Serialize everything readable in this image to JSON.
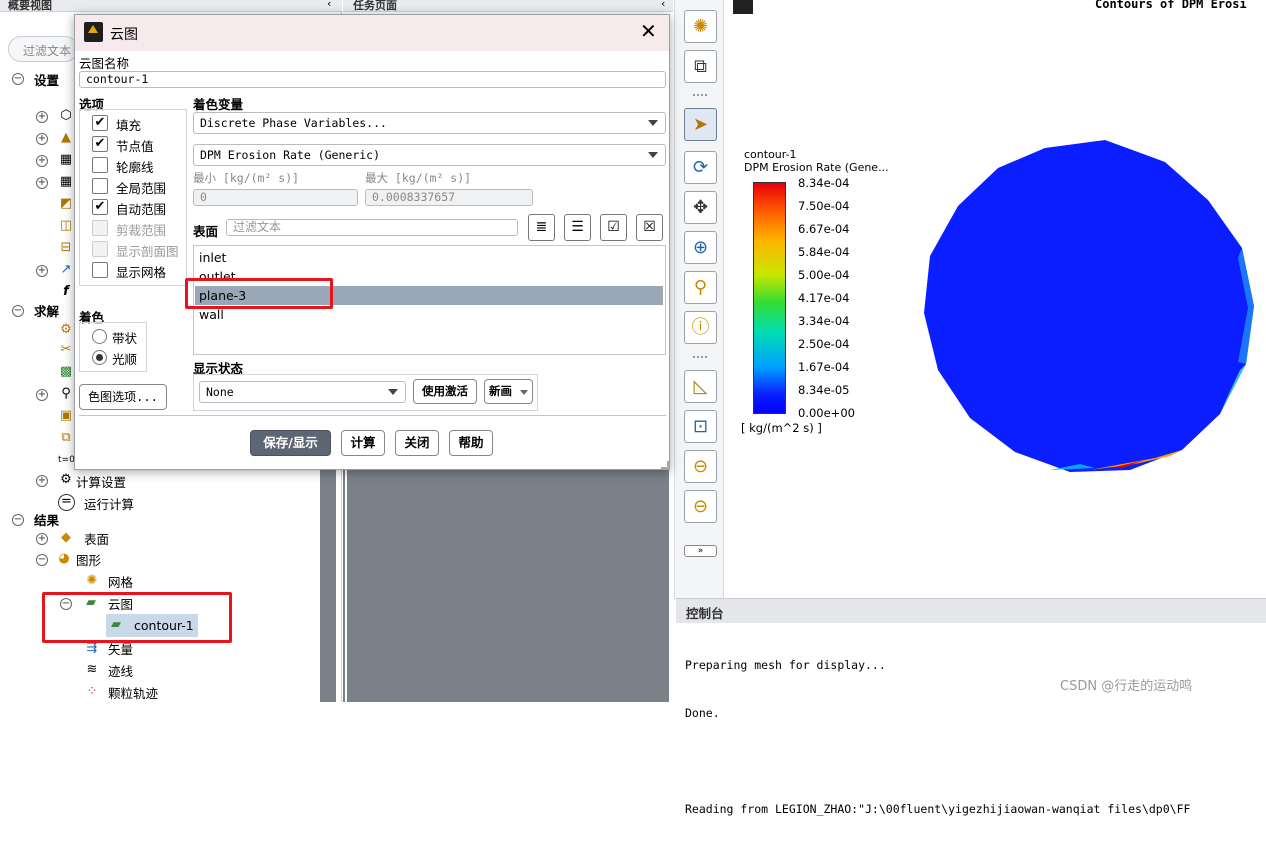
{
  "tree": {
    "header": "概要视图",
    "filter_placeholder": "过滤文本",
    "section_setup": "设置",
    "section_solution": "求解",
    "item_calc_settings": "计算设置",
    "item_run_calc": "运行计算",
    "section_results": "结果",
    "item_surfaces": "表面",
    "item_graphics": "图形",
    "item_mesh": "网格",
    "item_contours": "云图",
    "item_contour1": "contour-1",
    "item_vectors": "矢量",
    "item_pathlines": "迹线",
    "item_particle_tracks": "颗粒轨迹"
  },
  "task_panel": {
    "header": "任务页面"
  },
  "dialog": {
    "title": "云图",
    "name_label": "云图名称",
    "name_value": "contour-1",
    "options_label": "选项",
    "options": [
      {
        "label": "填充",
        "checked": true,
        "disabled": false
      },
      {
        "label": "节点值",
        "checked": true,
        "disabled": false
      },
      {
        "label": "轮廓线",
        "checked": false,
        "disabled": false
      },
      {
        "label": "全局范围",
        "checked": false,
        "disabled": false
      },
      {
        "label": "自动范围",
        "checked": true,
        "disabled": false
      },
      {
        "label": "剪裁范围",
        "checked": false,
        "disabled": true
      },
      {
        "label": "显示剖面图",
        "checked": false,
        "disabled": true
      },
      {
        "label": "显示网格",
        "checked": false,
        "disabled": false
      }
    ],
    "coloring_label": "着色",
    "coloring": [
      {
        "label": "带状",
        "selected": false
      },
      {
        "label": "光顺",
        "selected": true
      }
    ],
    "colormap_button": "色图选项...",
    "color_var_label": "着色变量",
    "color_var_category": "Discrete Phase Variables...",
    "color_var_field": "DPM Erosion Rate (Generic)",
    "min_label": "最小 [kg/(m² s)]",
    "max_label": "最大 [kg/(m² s)]",
    "min_value": "0",
    "max_value": "0.0008337657",
    "surfaces_label": "表面",
    "surfaces_filter_placeholder": "过滤文本",
    "surfaces": [
      {
        "label": "inlet",
        "selected": false
      },
      {
        "label": "outlet",
        "selected": false
      },
      {
        "label": "plane-3",
        "selected": true
      },
      {
        "label": "wall",
        "selected": false
      }
    ],
    "display_state_label": "显示状态",
    "display_state_value": "None",
    "use_active_button": "使用激活",
    "new_button": "新画",
    "save_display_button": "保存/显示",
    "compute_button": "计算",
    "close_button": "关闭",
    "help_button": "帮助"
  },
  "graphics": {
    "title": "Contours of DPM Erosi",
    "legend_name": "contour-1",
    "legend_var": "DPM Erosion Rate (Gene...",
    "legend_unit": "[ kg/(m^2 s) ]",
    "legend_values": [
      "8.34e-04",
      "7.50e-04",
      "6.67e-04",
      "5.84e-04",
      "5.00e-04",
      "4.17e-04",
      "3.34e-04",
      "2.50e-04",
      "1.67e-04",
      "8.34e-05",
      "0.00e+00"
    ]
  },
  "console": {
    "header": "控制台",
    "lines": [
      "Preparing mesh for display...",
      "Done.",
      "",
      "Reading from LEGION_ZHAO:\"J:\\00fluent\\yigezhijiaowan-wanqiat files\\dp0\\FF"
    ],
    "watermark": "CSDN @行走的运动鸣"
  },
  "colors": {
    "accent_red": "#e8141c",
    "selected_row": "#9aa7b6",
    "contour_blue": "#0a1eff"
  }
}
